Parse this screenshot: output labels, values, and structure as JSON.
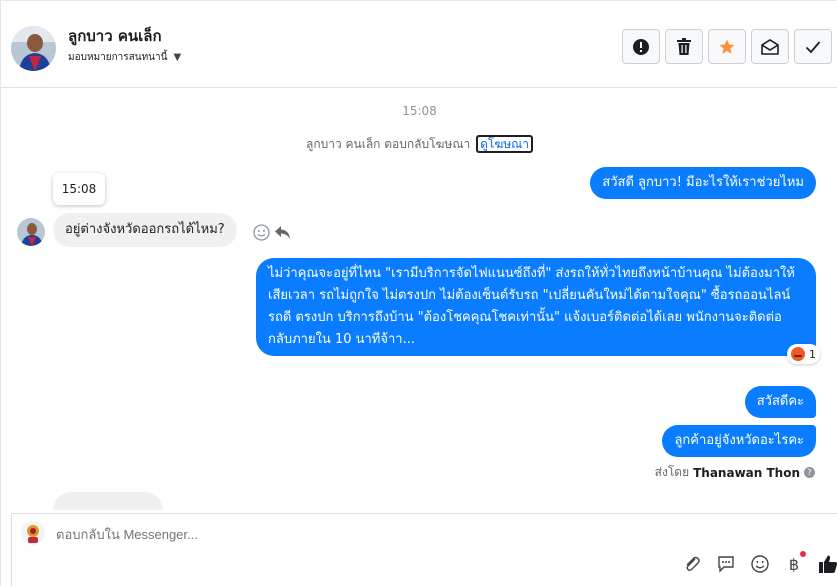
{
  "header": {
    "contact_name": "ลูกบาว คนเล็ก",
    "assign_label": "มอบหมายการสนทนานี้",
    "actions": [
      "spam",
      "delete",
      "star",
      "mark-unread",
      "done"
    ]
  },
  "thread": {
    "time_top": "15:08",
    "ad_reply_text": "ลูกบาว คนเล็ก ตอบกลับโฆษณา",
    "ad_link": "ดูโฆษณา",
    "tooltip_time": "15:08",
    "messages": [
      {
        "from": "page",
        "text": "สวัสดี ลูกบาว! มีอะไรให้เราช่วยไหม"
      },
      {
        "from": "user",
        "text": "อยู่ต่างจังหวัดออกรถได้ไหม?"
      },
      {
        "from": "page",
        "text": "ไม่ว่าคุณจะอยู่ที่ไหน \"เรามีบริการจัดไฟแนนซ์ถึงที่\"  ส่งรถให้ทั่วไทยถึงหน้าบ้านคุณ ไม่ต้องมาให้เสียเวลา รถไม่ถูกใจ ไม่ตรงปก ไม่ต้องเซ็นต์รับรถ \"เปลี่ยนคันใหม่ได้ตามใจคุณ\" ซื้อรถออนไลน์ รถดี ตรงปก บริการถึงบ้าน \"ต้องโชคคุณโชคเท่านั้น\" แจ้งเบอร์ติดต่อได้เลย พนักงานจะติดต่อกลับภายใน 10 นาทีจ้าา..."
      },
      {
        "from": "page",
        "text": "สวัสดีคะ"
      },
      {
        "from": "page",
        "text": "ลูกค้าอยู่จังหวัดอะไรคะ"
      }
    ],
    "reaction_count": "1",
    "sent_by_label": "ส่งโดย",
    "sent_by_name": "Thanawan Thon"
  },
  "composer": {
    "placeholder": "ตอบกลับใน Messenger..."
  },
  "colors": {
    "outgoing_bubble": "#0a7cff",
    "incoming_bubble": "#f0f0f0",
    "star": "#f7923b",
    "like": "#1c1e21"
  }
}
